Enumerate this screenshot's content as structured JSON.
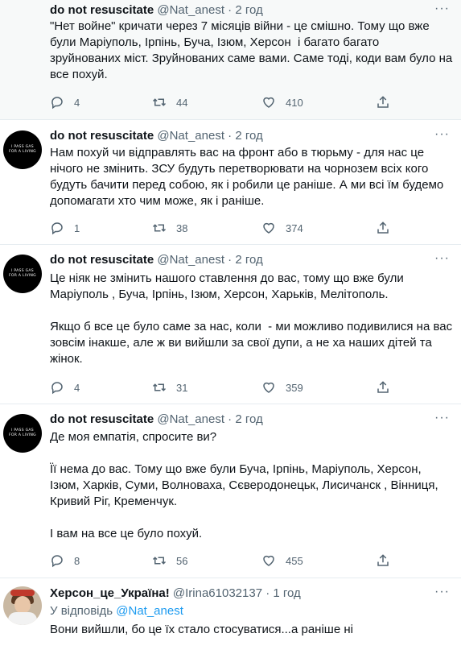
{
  "tweets": [
    {
      "name": "do not resuscitate",
      "handle": "@Nat_anest",
      "dot": "·",
      "time": "2 год",
      "avatar_text": [
        "I PASS GAS",
        "FOR A LIVING"
      ],
      "text": "\"Нет войне\" кричати через 7 місяців війни - це смішно. Тому що вже були Маріуполь, Ірпінь, Буча, Ізюм, Херсон  і багато багато зруйнованих міст. Зруйнованих саме вами. Саме тоді, коди вам було на все похуй.",
      "replies": "4",
      "retweets": "44",
      "likes": "410"
    },
    {
      "name": "do not resuscitate",
      "handle": "@Nat_anest",
      "dot": "·",
      "time": "2 год",
      "avatar_text": [
        "I PASS GAS",
        "FOR A LIVING"
      ],
      "text": "Нам похуй чи відправлять вас на фронт або в тюрьму - для нас це нічого не змінить. ЗСУ будуть перетворювати на чорнозем всіх кого будуть бачити перед собою, як і робили це раніше. А ми всі їм будемо допомагати хто чим може, як і раніше.",
      "replies": "1",
      "retweets": "38",
      "likes": "374"
    },
    {
      "name": "do not resuscitate",
      "handle": "@Nat_anest",
      "dot": "·",
      "time": "2 год",
      "avatar_text": [
        "I PASS GAS",
        "FOR A LIVING"
      ],
      "text": "Це ніяк не змінить нашого ставлення до вас, тому що вже були Маріуполь , Буча, Ірпінь, Ізюм, Херсон, Харьків, Мелітополь.\n\nЯкщо б все це було саме за нас, коли  - ми можливо подивилися на вас зовсім інакше, але ж ви вийшли за свої дупи, а не ха наших дітей та жінок.",
      "replies": "4",
      "retweets": "31",
      "likes": "359"
    },
    {
      "name": "do not resuscitate",
      "handle": "@Nat_anest",
      "dot": "·",
      "time": "2 год",
      "avatar_text": [
        "I PASS GAS",
        "FOR A LIVING"
      ],
      "text": "Де моя емпатія, спросите ви?\n\nЇї нема до вас. Тому що вже були Буча, Ірпінь, Маріуполь, Херсон, Ізюм, Харків, Суми, Волноваха, Сєверодонецьк, Лисичанск , Вінниця, Кривий Ріг, Кременчук.\n\nІ вам на все це було похуй.",
      "replies": "8",
      "retweets": "56",
      "likes": "455"
    },
    {
      "name": "Херсон_це_Україна!",
      "handle": "@Irina61032137",
      "dot": "·",
      "time": "1 год",
      "reply_prefix": "У відповідь",
      "reply_handle": "@Nat_anest",
      "text": "Вони вийшли, бо це їх стало стосуватися...а раніше ні"
    }
  ],
  "more_label": "···",
  "colors": {
    "secondary": "#536471",
    "link": "#1d9bf0",
    "border": "#e6ecf0"
  }
}
